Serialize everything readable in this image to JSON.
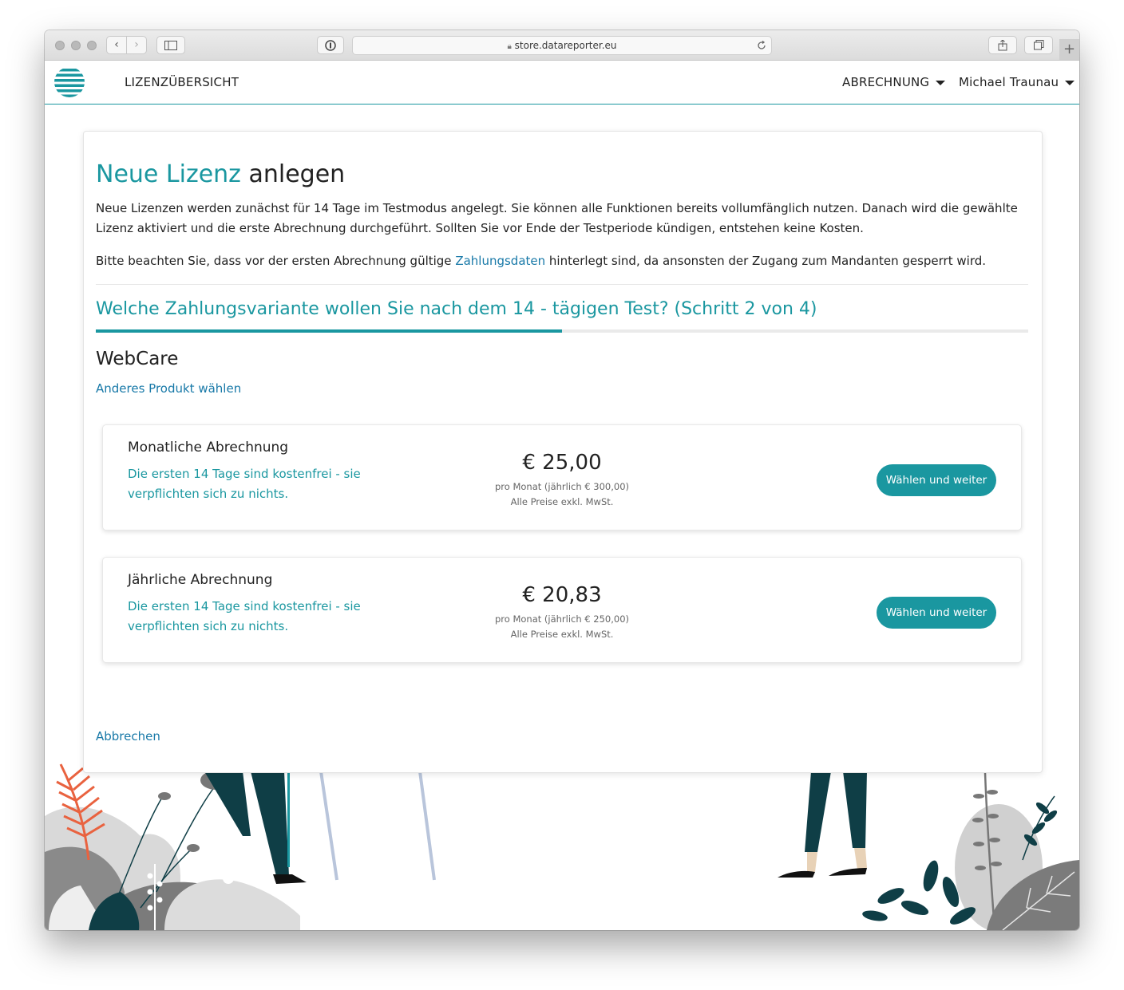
{
  "browser": {
    "url": "store.datareporter.eu"
  },
  "navbar": {
    "license_overview": "LIZENZÜBERSICHT",
    "billing_menu": "ABRECHNUNG",
    "user_menu": "Michael Traunau"
  },
  "page": {
    "title_highlight": "Neue Lizenz",
    "title_rest": " anlegen",
    "intro": "Neue Lizenzen werden zunächst für 14 Tage im Testmodus angelegt. Sie können alle Funktionen bereits vollumfänglich nutzen. Danach wird die gewählte Lizenz aktiviert und die erste Abrechnung durchgeführt. Sollten Sie vor Ende der Testperiode kündigen, entstehen keine Kosten.",
    "notice_before": "Bitte beachten Sie, dass vor der ersten Abrechnung gültige ",
    "notice_link": "Zahlungsdaten",
    "notice_after": " hinterlegt sind, da ansonsten der Zugang zum Mandanten gesperrt wird.",
    "step_title": "Welche Zahlungsvariante wollen Sie nach dem 14 - tägigen Test? (Schritt 2 von 4)",
    "step_progress": 0.5,
    "product_name": "WebCare",
    "other_product_link": "Anderes Produkt wählen",
    "cancel_link": "Abbrechen"
  },
  "plans": [
    {
      "title": "Monatliche Abrechnung",
      "note": "Die ersten 14 Tage sind kostenfrei - sie verpflichten sich zu nichts.",
      "price": "€ 25,00",
      "per_month": "pro Monat (jährlich € 300,00)",
      "tax_note": "Alle Preise exkl. MwSt.",
      "button": "Wählen und weiter"
    },
    {
      "title": "Jährliche Abrechnung",
      "note": "Die ersten 14 Tage sind kostenfrei - sie verpflichten sich zu nichts.",
      "price": "€ 20,83",
      "per_month": "pro Monat (jährlich € 250,00)",
      "tax_note": "Alle Preise exkl. MwSt.",
      "button": "Wählen und weiter"
    }
  ],
  "colors": {
    "accent": "#1a97a0",
    "link": "#1879a8",
    "dark_green": "#0f3e46",
    "coral": "#e9623f"
  }
}
